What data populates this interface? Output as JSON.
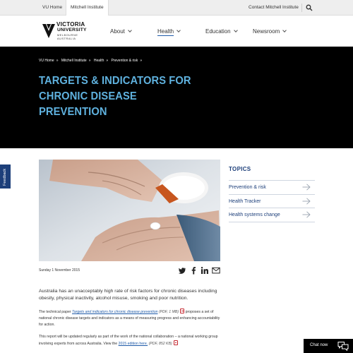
{
  "utility": {
    "vu_home": "VU Home",
    "mitchell": "Mitchell Institute",
    "contact": "Contact Mitchell Institute",
    "search_icon": "search-icon"
  },
  "logo": {
    "line1": "VICTORIA",
    "line2": "UNIVERSITY",
    "line3": "MELBOURNE AUSTRALIA"
  },
  "nav": {
    "items": [
      {
        "label": "About"
      },
      {
        "label": "Health"
      },
      {
        "label": "Education"
      },
      {
        "label": "Newsroom"
      }
    ],
    "active": "Health"
  },
  "breadcrumb": {
    "items": [
      "VU Home",
      "Mitchell Institute",
      "Health",
      "Prevention & risk"
    ],
    "separator": "»"
  },
  "hero": {
    "title_line1": "TARGETS & INDICATORS FOR",
    "title_line2": "CHRONIC DISEASE PREVENTION"
  },
  "feedback": {
    "label": "Feedback"
  },
  "article": {
    "date": "Sunday 1 November 2015",
    "para1": "Australia has an unacceptably high rate of risk factors for chronic diseases including obesity, physical inactivity, alcohol misuse, smoking and poor nutrition.",
    "para2_pre": "The technical paper ",
    "para2_link": "Targets and indicators for chronic disease prevention",
    "para2_meta": "(PDF, 1 MB)",
    "para2_post": "proposes a set of national chronic disease targets and indicators as a means of measuring progress and enhancing accountability for action.",
    "para3_pre": "This report will be updated regularly as part of the work of the national collaboration – a national working group involving experts from across Australia. View the ",
    "para3_link": "2015 edition here.",
    "para3_meta": "(PDF, 852 KB)"
  },
  "share": [
    "twitter-icon",
    "facebook-icon",
    "linkedin-icon",
    "email-icon"
  ],
  "sidebar": {
    "title": "TOPICS",
    "topics": [
      {
        "label": "Prevention & risk"
      },
      {
        "label": "Health Tracker"
      },
      {
        "label": "Health systems change"
      }
    ]
  },
  "chat": {
    "label": "Chat now"
  },
  "colors": {
    "brand_navy": "#1d3f7a",
    "title_blue": "#5fb1de",
    "link_blue": "#1e5aa8",
    "hero_bg": "#000000"
  }
}
